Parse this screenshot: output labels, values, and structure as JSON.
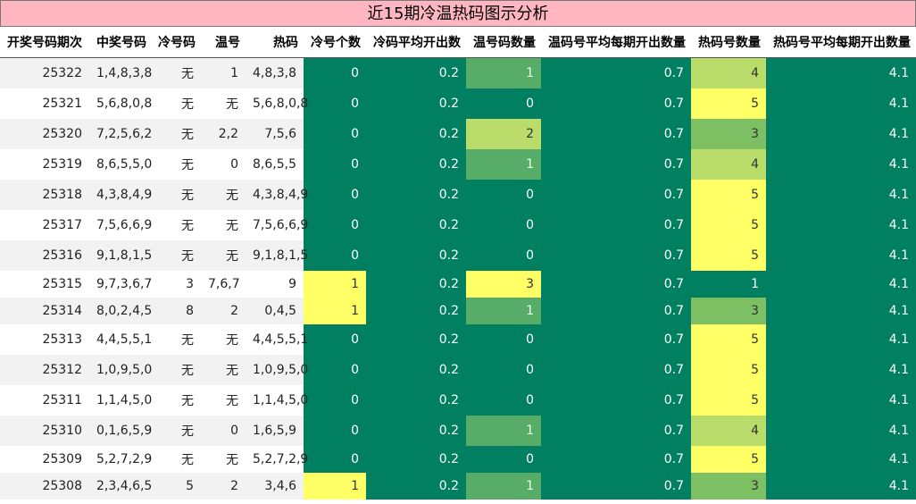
{
  "title": "近15期冷温热码图示分析",
  "headers": [
    "开奖号码期次",
    "中奖号码",
    "冷号码",
    "温号",
    "热码",
    "冷号个数",
    "冷码平均开出数",
    "温号码数量",
    "温码号平均每期开出数量",
    "热码号数量",
    "热码号平均每期开出数量"
  ],
  "rows": [
    [
      "25322",
      "1,4,8,3,8",
      "无",
      "1",
      "4,8,3,8",
      "0",
      "0.2",
      "1",
      "0.7",
      "4",
      "4.1"
    ],
    [
      "25321",
      "5,6,8,0,8",
      "无",
      "无",
      "5,6,8,0,8",
      "0",
      "0.2",
      "0",
      "0.7",
      "5",
      "4.1"
    ],
    [
      "25320",
      "7,2,5,6,2",
      "无",
      "2,2",
      "7,5,6",
      "0",
      "0.2",
      "2",
      "0.7",
      "3",
      "4.1"
    ],
    [
      "25319",
      "8,6,5,5,0",
      "无",
      "0",
      "8,6,5,5",
      "0",
      "0.2",
      "1",
      "0.7",
      "4",
      "4.1"
    ],
    [
      "25318",
      "4,3,8,4,9",
      "无",
      "无",
      "4,3,8,4,9",
      "0",
      "0.2",
      "0",
      "0.7",
      "5",
      "4.1"
    ],
    [
      "25317",
      "7,5,6,6,9",
      "无",
      "无",
      "7,5,6,6,9",
      "0",
      "0.2",
      "0",
      "0.7",
      "5",
      "4.1"
    ],
    [
      "25316",
      "9,1,8,1,5",
      "无",
      "无",
      "9,1,8,1,5",
      "0",
      "0.2",
      "0",
      "0.7",
      "5",
      "4.1"
    ],
    [
      "25315",
      "9,7,3,6,7",
      "3",
      "7,6,7",
      "9",
      "1",
      "0.2",
      "3",
      "0.7",
      "1",
      "4.1"
    ],
    [
      "25314",
      "8,0,2,4,5",
      "8",
      "2",
      "0,4,5",
      "1",
      "0.2",
      "1",
      "0.7",
      "3",
      "4.1"
    ],
    [
      "25313",
      "4,4,5,5,1",
      "无",
      "无",
      "4,4,5,5,1",
      "0",
      "0.2",
      "0",
      "0.7",
      "5",
      "4.1"
    ],
    [
      "25312",
      "1,0,9,5,0",
      "无",
      "无",
      "1,0,9,5,0",
      "0",
      "0.2",
      "0",
      "0.7",
      "5",
      "4.1"
    ],
    [
      "25311",
      "1,1,4,5,0",
      "无",
      "无",
      "1,1,4,5,0",
      "0",
      "0.2",
      "0",
      "0.7",
      "5",
      "4.1"
    ],
    [
      "25310",
      "0,1,6,5,9",
      "无",
      "0",
      "1,6,5,9",
      "0",
      "0.2",
      "1",
      "0.7",
      "4",
      "4.1"
    ],
    [
      "25309",
      "5,2,7,2,9",
      "无",
      "无",
      "5,2,7,2,9",
      "0",
      "0.2",
      "0",
      "0.7",
      "5",
      "4.1"
    ],
    [
      "25308",
      "2,3,4,6,5",
      "5",
      "2",
      "3,4,6",
      "1",
      "0.2",
      "1",
      "0.7",
      "3",
      "4.1"
    ]
  ],
  "colors": {
    "title_bg": "#ffb6c1",
    "row_shade": "#f2f2f2",
    "dark_green": "#008060",
    "yellow": "#ffff66",
    "light_green": "#b9dc6a",
    "mid_green": "#7dbf63",
    "green": "#57ad67"
  }
}
